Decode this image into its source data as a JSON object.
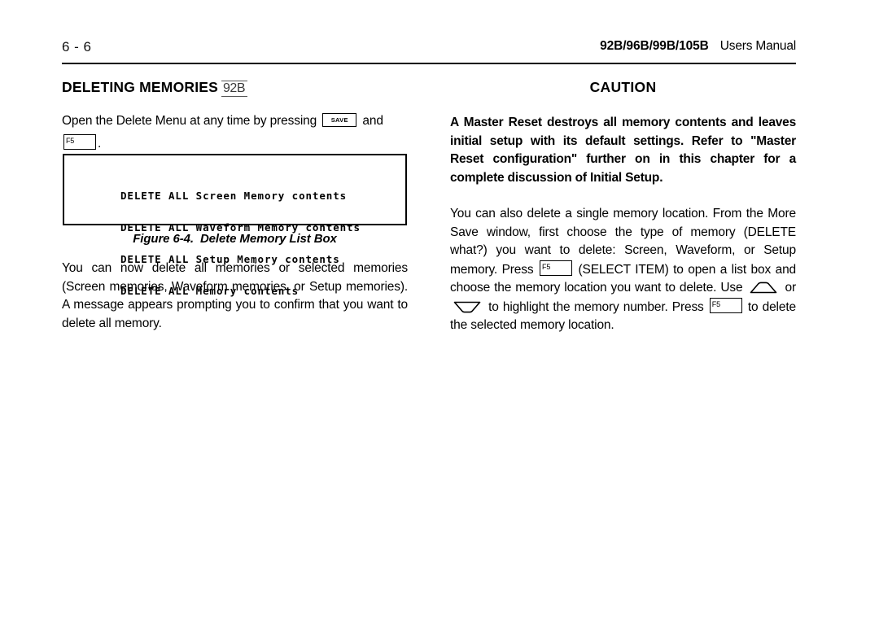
{
  "header": {
    "page_number": "6 - 6",
    "models": "92B/96B/99B/105B",
    "manual": "Users Manual"
  },
  "left_column": {
    "section_title": "DELETING MEMORIES",
    "section_title_model": "92B",
    "intro_text_before_save": "Open the Delete Menu at any time by pressing",
    "save_key_label": "SAVE",
    "intro_text_after_save": "and",
    "f5_key_label": "F5",
    "intro_text_end": ".",
    "lcd_lines": [
      "DELETE ALL Screen Memory contents",
      "DELETE ALL Waveform Memory contents",
      "DELETE ALL Setup Memory contents",
      "DELETE ALL Memory contents"
    ],
    "figure_number": "Figure 6-4.",
    "figure_title": "Delete Memory List Box",
    "paragraph": "You can now delete all memories or selected memories (Screen memories, Waveform memories, or Setup memories). A message appears prompting you to confirm that you want to delete all memory."
  },
  "right_column": {
    "caution_heading": "CAUTION",
    "caution_body": "A Master Reset destroys all memory contents and leaves initial setup with its default settings. Refer to \"Master Reset configuration\" further on in this chapter for a complete discussion of Initial Setup.",
    "paragraph_part1": "You can also delete a single memory location. From the More Save window, first choose the type of memory (DELETE what?) you want to delete: Screen, Waveform, or Setup memory. Press",
    "f5_key_label_1": "F5",
    "paragraph_part2": "(SELECT ITEM) to open a list box and choose the memory location you want to delete. Use",
    "up_arrow_icon": "up-arrow-key",
    "paragraph_part3": "or",
    "down_arrow_icon": "down-arrow-key",
    "paragraph_part4": "to highlight the memory number. Press",
    "f5_key_label_2": "F5",
    "paragraph_part5": "to delete the selected memory location."
  }
}
